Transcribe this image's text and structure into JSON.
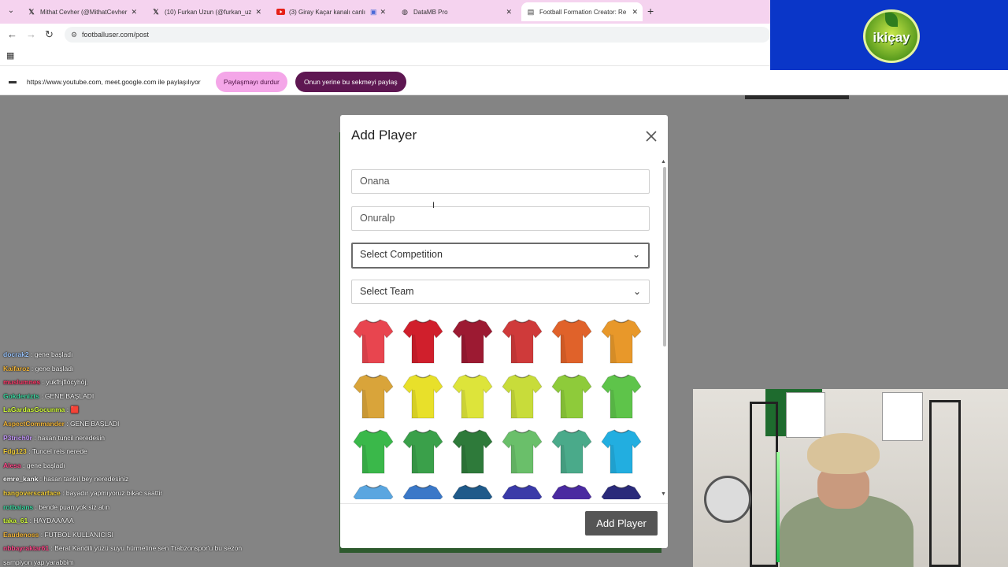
{
  "browser": {
    "tabs": [
      {
        "label": "Mithat Cevher (@MithatCevher",
        "icon": "x-logo-icon",
        "active": false
      },
      {
        "label": "(10) Furkan Uzun (@furkan_uz",
        "icon": "x-logo-icon",
        "active": false
      },
      {
        "label": "(3) Giray Kaçar kanalı canlı y",
        "icon": "youtube-icon",
        "active": false
      },
      {
        "label": "DataMB Pro",
        "icon": "globe-icon",
        "active": false
      },
      {
        "label": "Football Formation Creator: Re",
        "icon": "page-icon",
        "active": true
      }
    ],
    "url": "footballuser.com/post"
  },
  "share_bar": {
    "text": "https://www.youtube.com, meet.google.com ile paylaşılıyor",
    "stop_label": "Paylaşmayı durdur",
    "share_tab_label": "Onun yerine bu sekmeyi paylaş"
  },
  "logo": {
    "text": "ikiçay"
  },
  "modal": {
    "title": "Add Player",
    "field_1_value": "Onana",
    "field_2_value": "Onuralp",
    "competition_placeholder": "Select Competition",
    "team_placeholder": "Select Team",
    "submit_label": "Add Player",
    "jersey_colors": [
      "#e8454f",
      "#d01f2c",
      "#9c1a32",
      "#cf3a3a",
      "#e0622a",
      "#e8982a",
      "#d9a43a",
      "#e8e02a",
      "#dde43a",
      "#c8dc3a",
      "#8ecb3a",
      "#5ec44a",
      "#3ab84a",
      "#3aa04a",
      "#2e7a3a",
      "#6abf6a",
      "#4aaa8a",
      "#22aee0",
      "#5aa6e0",
      "#3a78c8",
      "#1f5a8a",
      "#3a3aa8",
      "#4a2aa0",
      "#2a2a7a"
    ]
  },
  "chat": [
    {
      "user": "docrak2",
      "message": "gene başladı",
      "color": "#9ec8ff"
    },
    {
      "user": "Kaifaroz",
      "message": "gene başladı",
      "color": "#f4b73a"
    },
    {
      "user": "muslumnes",
      "message": "yukfhjflöcyhöj,",
      "color": "#ff3a6a"
    },
    {
      "user": "Gokdenizts",
      "message": "GENE BAŞLADI",
      "color": "#3ad8a0"
    },
    {
      "user": "LaGardasGocunma",
      "message": "🟥",
      "color": "#d4ff3a"
    },
    {
      "user": "AspectCommander",
      "message": "GENE BAŞLADI",
      "color": "#f4b73a"
    },
    {
      "user": "P3trich0r",
      "message": "hasan tuncil neredesin",
      "color": "#c89aff"
    },
    {
      "user": "Fdg123",
      "message": "Tuncel reis nerede",
      "color": "#f4d03a"
    },
    {
      "user": "Alesa",
      "message": "gene başladı",
      "color": "#ff4a8a"
    },
    {
      "user": "emre_kank",
      "message": "hasan tankıl bey neredesiniz",
      "color": "#ffffff"
    },
    {
      "user": "hangoverscarface",
      "message": "bayadır yapmıyoruz bikac saattir",
      "color": "#f4d03a"
    },
    {
      "user": "rotbaians",
      "message": "bende puan yok siz atın",
      "color": "#3ad8a0"
    },
    {
      "user": "taka_61",
      "message": "HAYDAAAAA",
      "color": "#d4ff3a"
    },
    {
      "user": "Eaudenoss",
      "message": "FUTBOL KULLANICISI",
      "color": "#f4b73a"
    },
    {
      "user": "nbbayraktar61",
      "message": "Berat Kandili yüzü suyu hürmetine sen Trabzonspor'u bu sezon",
      "color": "#ff4a8a"
    },
    {
      "user": "",
      "message": "şampiyon yap yarabbim",
      "color": "#ffffff"
    }
  ]
}
